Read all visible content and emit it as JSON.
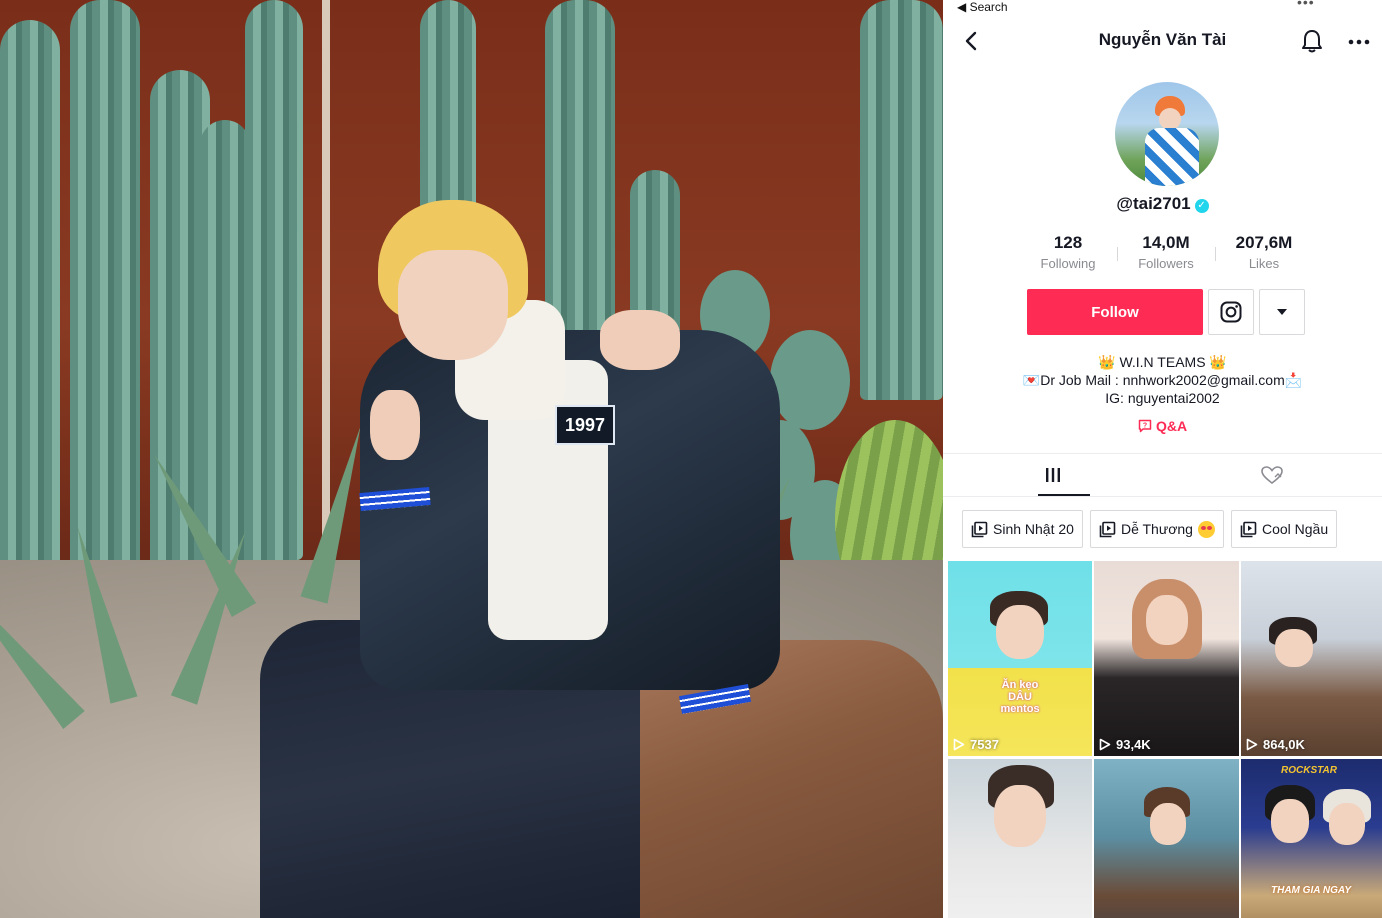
{
  "statusbar": {
    "back_label": "◀ Search",
    "dots": "•••"
  },
  "nav": {
    "title": "Nguyễn Văn Tài"
  },
  "profile": {
    "username": "@tai2701",
    "stats": [
      {
        "value": "128",
        "label": "Following"
      },
      {
        "value": "14,0M",
        "label": "Followers"
      },
      {
        "value": "207,6M",
        "label": "Likes"
      }
    ],
    "follow_label": "Follow",
    "bio_lines": [
      "👑 W.I.N TEAMS 👑",
      "💌Dr Job  Mail : nnhwork2002@gmail.com📩",
      "IG: nguyentai2002"
    ],
    "qa_label": "Q&A"
  },
  "playlists": [
    {
      "label": "Sinh Nhật 20"
    },
    {
      "label": "Dễ Thương"
    },
    {
      "label": "Cool Ngầu"
    }
  ],
  "videos": [
    {
      "views": "7537",
      "overlay": "Ăn kẹo DÂU mentos"
    },
    {
      "views": "93,4K"
    },
    {
      "views": "864,0K"
    },
    {
      "views": ""
    },
    {
      "views": ""
    },
    {
      "views": "",
      "overlay": "THAM GIA NGAY"
    }
  ],
  "photo": {
    "jacket_patch": "1997"
  },
  "colors": {
    "accent": "#fe2c55",
    "verified": "#20d5ec",
    "text": "#161823"
  }
}
